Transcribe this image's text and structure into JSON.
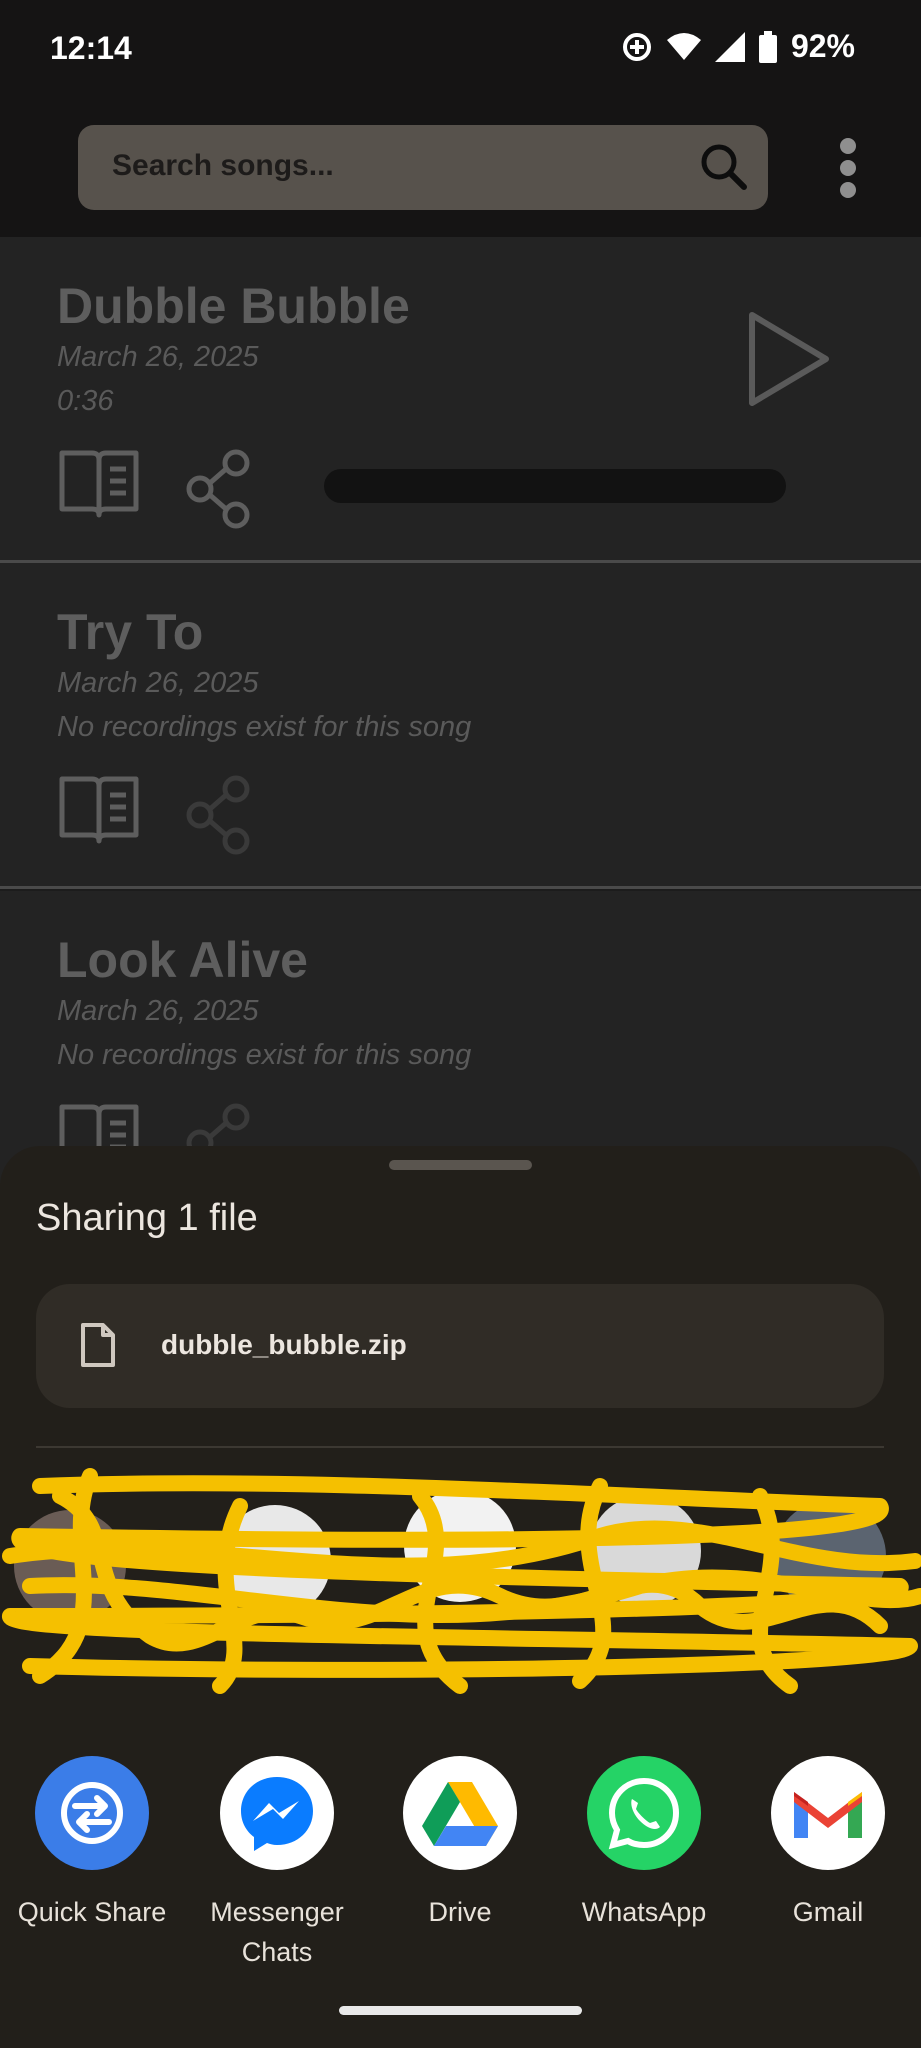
{
  "status_bar": {
    "time": "12:14",
    "battery_percent": "92%"
  },
  "app_bar": {
    "search_placeholder": "Search songs..."
  },
  "songs": [
    {
      "title": "Dubble Bubble",
      "date": "March 26, 2025",
      "subtitle": "0:36"
    },
    {
      "title": "Try To",
      "date": "March 26, 2025",
      "subtitle": "No recordings exist for this song"
    },
    {
      "title": "Look Alive",
      "date": "March 26, 2025",
      "subtitle": "No recordings exist for this song"
    }
  ],
  "share_sheet": {
    "title": "Sharing 1 file",
    "file_name": "dubble_bubble.zip",
    "apps": [
      {
        "label": "Quick Share",
        "icon": "quick-share-icon"
      },
      {
        "label": "Messenger Chats",
        "icon": "messenger-icon"
      },
      {
        "label": "Drive",
        "icon": "drive-icon"
      },
      {
        "label": "WhatsApp",
        "icon": "whatsapp-icon"
      },
      {
        "label": "Gmail",
        "icon": "gmail-icon"
      }
    ]
  },
  "colors": {
    "accent_scribble": "#f5c000",
    "quick_share": "#3b7de8",
    "whatsapp": "#25d366"
  }
}
